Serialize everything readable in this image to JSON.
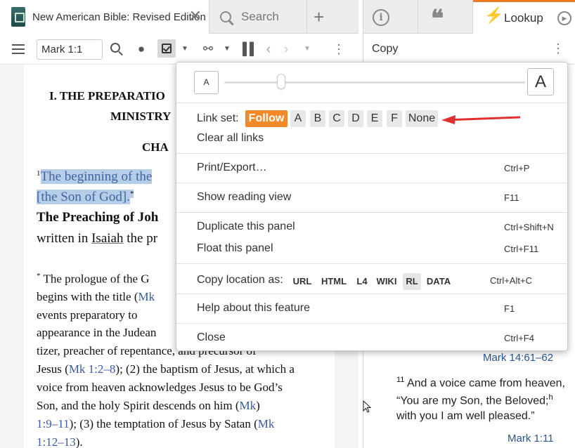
{
  "left_panel": {
    "tabs": {
      "book_title": "New American Bible: Revised Edition",
      "search_label": "Search",
      "add_label": "+"
    },
    "toolbar": {
      "reference_value": "Mark 1:1"
    },
    "content": {
      "section_heading_line1": "I. THE PREPARATIO",
      "section_heading_line2": "MINISTRY",
      "chapter_heading": "CHA",
      "verse_num": "1",
      "verse_line1": "The beginning of the",
      "verse_line2": "[the Son of God].",
      "footnote_marker": "*",
      "pericope_heading": "The Preaching of Joh",
      "verse_line3_a": "written in ",
      "verse_line3_link": "Isaiah",
      "verse_line3_b": " the pr",
      "footnote_lines": [
        {
          "text": "The prologue of the G",
          "prefix": "*"
        },
        {
          "text": "begins with the title (",
          "link": "Mk"
        },
        {
          "text": "events preparatory to"
        },
        {
          "text": "appearance in the Judean"
        },
        {
          "text": "tizer, preacher of repentance, and precursor of"
        },
        {
          "text": "Jesus (",
          "link": "Mk 1:2–8",
          "suffix": "); (2) the baptism of Jesus, at which a"
        },
        {
          "text": "voice from heaven acknowledges Jesus to be God’s"
        },
        {
          "text": "Son, and the holy Spirit descends on him (",
          "link": "Mk"
        },
        {
          "link": "1:9–11",
          "text": "",
          "suffix": "); (3) the temptation of Jesus by Satan ("
        },
        {
          "link": "1:12–13",
          "text": "",
          "suffix": ")."
        }
      ],
      "footnote_tail_link": "Mk"
    }
  },
  "right_panel": {
    "tabs": {
      "lookup_label": "Lookup"
    },
    "toolbar": {
      "copy_label": "Copy"
    },
    "content": {
      "ref1": "Mark 14:61–62",
      "verse_num": "11",
      "verse_text_a": "And a voice came from heaven, “You are my Son, the Beloved;",
      "verse_note": "h",
      "verse_text_b": " with you I am well pleased.”",
      "ref2": "Mark 1:11"
    }
  },
  "menu": {
    "font_small": "A",
    "font_large": "A",
    "font_size_level": 0.19,
    "link_set_label": "Link set:",
    "link_set_options": [
      "Follow",
      "A",
      "B",
      "C",
      "D",
      "E",
      "F",
      "None"
    ],
    "link_set_selected": "Follow",
    "clear_links": "Clear all links",
    "print_export": {
      "label": "Print/Export…",
      "shortcut": "Ctrl+P"
    },
    "reading_view": {
      "label": "Show reading view",
      "shortcut": "F11"
    },
    "duplicate": {
      "label": "Duplicate this panel",
      "shortcut": "Ctrl+Shift+N"
    },
    "float": {
      "label": "Float this panel",
      "shortcut": "Ctrl+F11"
    },
    "copy_location": {
      "label": "Copy location as:",
      "formats": [
        "URL",
        "HTML",
        "L4",
        "WIKI",
        "RL",
        "DATA"
      ],
      "selected": "RL",
      "shortcut": "Ctrl+Alt+C"
    },
    "help": {
      "label": "Help about this feature",
      "shortcut": "F1"
    },
    "close": {
      "label": "Close",
      "shortcut": "Ctrl+F4"
    }
  },
  "colors": {
    "accent_orange": "#f28a2a",
    "arrow_red": "#e03030",
    "highlight_blue": "#b6cde8",
    "link_blue": "#2a5590"
  }
}
